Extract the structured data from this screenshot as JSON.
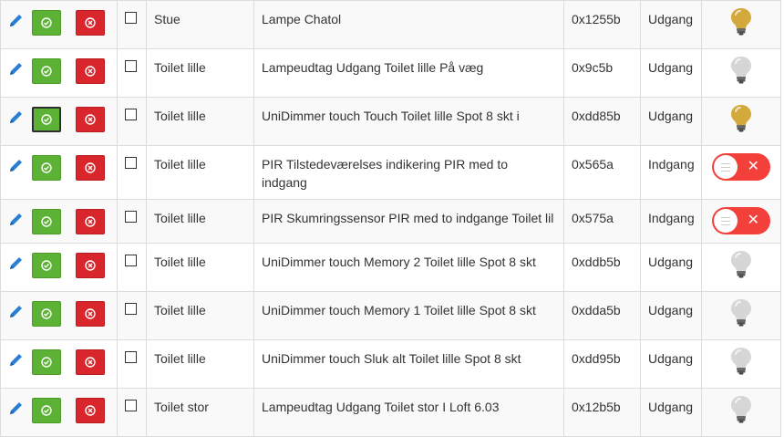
{
  "rows": [
    {
      "room": "Stue",
      "name": "Lampe Chatol",
      "address": "0x1255b",
      "type": "Udgang",
      "status": "bulb-on"
    },
    {
      "room": "Toilet lille",
      "name": "Lampeudtag Udgang Toilet lille På væg",
      "address": "0x9c5b",
      "type": "Udgang",
      "status": "bulb-off"
    },
    {
      "room": "Toilet lille",
      "name": "UniDimmer touch Touch Toilet lille Spot 8 skt i",
      "address": "0xdd85b",
      "type": "Udgang",
      "status": "bulb-on"
    },
    {
      "room": "Toilet lille",
      "name": "PIR Tilstedeværelses indikering PIR med to indgang",
      "address": "0x565a",
      "type": "Indgang",
      "status": "toggle-off"
    },
    {
      "room": "Toilet lille",
      "name": "PIR Skumringssensor PIR med to indgange Toilet lil",
      "address": "0x575a",
      "type": "Indgang",
      "status": "toggle-off"
    },
    {
      "room": "Toilet lille",
      "name": "UniDimmer touch Memory 2 Toilet lille Spot 8 skt",
      "address": "0xddb5b",
      "type": "Udgang",
      "status": "bulb-off"
    },
    {
      "room": "Toilet lille",
      "name": "UniDimmer touch Memory 1 Toilet lille Spot 8 skt",
      "address": "0xdda5b",
      "type": "Udgang",
      "status": "bulb-off"
    },
    {
      "room": "Toilet lille",
      "name": "UniDimmer touch Sluk alt Toilet lille Spot 8 skt",
      "address": "0xdd95b",
      "type": "Udgang",
      "status": "bulb-off"
    },
    {
      "room": "Toilet stor",
      "name": "Lampeudtag Udgang Toilet stor I Loft 6.03",
      "address": "0x12b5b",
      "type": "Udgang",
      "status": "bulb-off"
    }
  ],
  "colors": {
    "ok_button": "#5cb234",
    "delete_button": "#d9262c",
    "bulb_on": "#d4a93c",
    "bulb_off": "#d6d6d6",
    "toggle_off": "#f4403a",
    "pencil": "#2a7fd4"
  },
  "icons": {
    "edit": "pencil-icon",
    "confirm": "check-circle-icon",
    "delete": "x-circle-icon",
    "on": "lightbulb-on-icon",
    "off": "lightbulb-off-icon",
    "toggle": "toggle-off-icon"
  }
}
